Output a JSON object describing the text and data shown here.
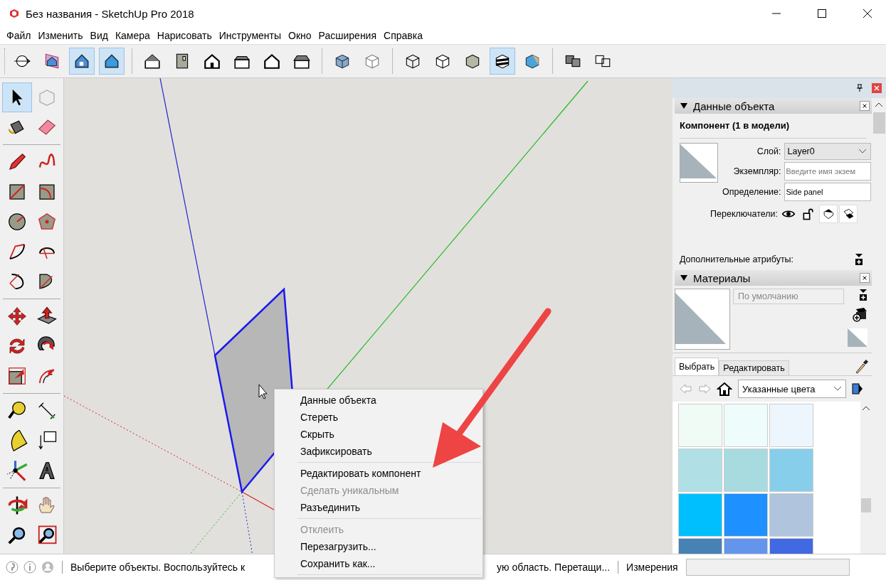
{
  "window": {
    "title": "Без названия - SketchUp Pro 2018"
  },
  "menu_bar": [
    "Файл",
    "Изменить",
    "Вид",
    "Камера",
    "Нарисовать",
    "Инструменты",
    "Окно",
    "Расширения",
    "Справка"
  ],
  "toolbar": {
    "groups": [
      [
        {
          "selected": false
        },
        {
          "selected": false
        },
        {
          "selected": true
        },
        {
          "selected": true
        }
      ],
      [
        {
          "selected": false
        },
        {
          "selected": false
        },
        {
          "selected": false
        },
        {
          "selected": false
        },
        {
          "selected": false
        },
        {
          "selected": false
        }
      ],
      [
        {
          "selected": false
        },
        {
          "selected": false
        }
      ],
      [
        {
          "selected": false
        },
        {
          "selected": false
        },
        {
          "selected": false
        },
        {
          "selected": true
        },
        {
          "selected": false
        }
      ],
      [
        {
          "selected": false
        },
        {
          "selected": false
        }
      ]
    ]
  },
  "tools": {
    "groups": [
      [
        {
          "selected": true
        },
        {
          "selected": false
        },
        {
          "selected": false
        },
        {
          "selected": false
        }
      ],
      [
        {
          "selected": false
        },
        {
          "selected": false
        },
        {
          "selected": false
        },
        {
          "selected": false
        },
        {
          "selected": false
        },
        {
          "selected": false
        },
        {
          "selected": false
        },
        {
          "selected": false
        },
        {
          "selected": false
        },
        {
          "selected": false
        }
      ],
      [
        {
          "selected": false
        },
        {
          "selected": false
        },
        {
          "selected": false
        },
        {
          "selected": false
        },
        {
          "selected": false
        },
        {
          "selected": false
        }
      ],
      [
        {
          "selected": false
        },
        {
          "selected": false
        },
        {
          "selected": false
        },
        {
          "selected": false
        },
        {
          "selected": false
        },
        {
          "selected": false
        }
      ],
      [
        {
          "selected": false
        },
        {
          "selected": false
        },
        {
          "selected": false
        },
        {
          "selected": false
        }
      ]
    ]
  },
  "context_menu": [
    {
      "kind": "item",
      "label": "Данные объекта",
      "disabled": false
    },
    {
      "kind": "item",
      "label": "Стереть",
      "disabled": false
    },
    {
      "kind": "item",
      "label": "Скрыть",
      "disabled": false
    },
    {
      "kind": "item",
      "label": "Зафиксировать",
      "disabled": false
    },
    {
      "kind": "separator"
    },
    {
      "kind": "item",
      "label": "Редактировать компонент",
      "disabled": false
    },
    {
      "kind": "item",
      "label": "Сделать уникальным",
      "disabled": true
    },
    {
      "kind": "item",
      "label": "Разъединить",
      "disabled": false
    },
    {
      "kind": "separator"
    },
    {
      "kind": "item",
      "label": "Отклеить",
      "disabled": true
    },
    {
      "kind": "item",
      "label": "Перезагрузить...",
      "disabled": false
    },
    {
      "kind": "item",
      "label": "Сохранить как...",
      "disabled": false
    },
    {
      "kind": "separator"
    }
  ],
  "entity_info": {
    "title": "Данные объекта",
    "heading": "Компонент (1 в модели)",
    "layer_label": "Слой:",
    "layer_value": "Layer0",
    "instance_label": "Экземпляр:",
    "instance_placeholder": "Введите имя экзем",
    "definition_label": "Определение:",
    "definition_value": "Side panel",
    "toggles_label": "Переключатели:",
    "toggles": [
      {
        "on": false
      },
      {
        "on": false
      },
      {
        "on": true
      },
      {
        "on": true
      }
    ],
    "advanced_label": "Дополнительные атрибуты:"
  },
  "materials": {
    "title": "Материалы",
    "name_placeholder": "По умолчанию",
    "tabs": [
      {
        "label": "Выбрать",
        "selected": true
      },
      {
        "label": "Редактировать",
        "selected": false
      }
    ],
    "collection": "Указанные цвета",
    "swatches": [
      {
        "color": "#f0fbf6"
      },
      {
        "color": "#eefcfc"
      },
      {
        "color": "#eef6fd"
      },
      {
        "color": "#b0e0e6"
      },
      {
        "color": "#a8dbe0"
      },
      {
        "color": "#87ceeb"
      },
      {
        "color": "#00bfff"
      },
      {
        "color": "#1e90ff"
      },
      {
        "color": "#b0c4de"
      },
      {
        "color": "#4682b4"
      },
      {
        "color": "#6495ed"
      },
      {
        "color": "#4169e1"
      }
    ]
  },
  "status_bar": {
    "message_left": "Выберите объекты. Воспользуйтесь к",
    "message_right": "ую область. Перетащи...",
    "measurements_label": "Измерения"
  }
}
